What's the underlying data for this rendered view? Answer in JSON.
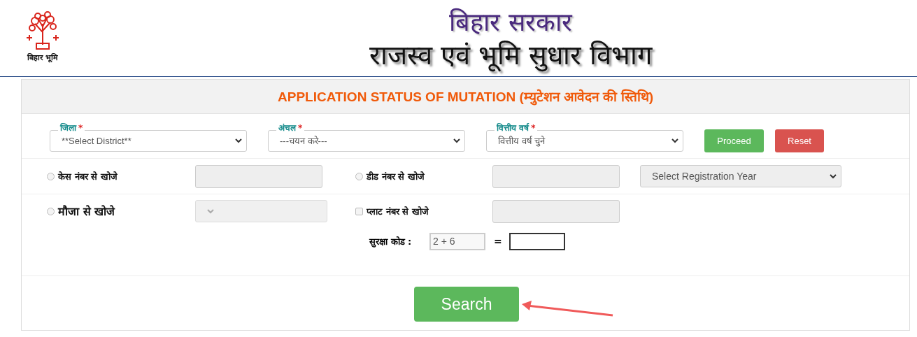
{
  "header": {
    "logo_caption": "बिहार भूमि",
    "title": "बिहार सरकार",
    "subtitle": "राजस्व एवं भूमि सुधार विभाग"
  },
  "form": {
    "heading": "APPLICATION STATUS OF MUTATION (म्युटेशन आवेदन की स्तिथि)",
    "filters": [
      {
        "label": "जिला",
        "required_mark": "*",
        "value": "**Select District**"
      },
      {
        "label": "अंचल",
        "required_mark": "*",
        "value": "---चयन करे---"
      },
      {
        "label": "वित्तीय वर्ष",
        "required_mark": "*",
        "value": "वित्तीय वर्ष चुने"
      }
    ],
    "buttons": [
      {
        "label": "Proceed",
        "kind": "success"
      },
      {
        "label": "Reset",
        "kind": "danger"
      }
    ],
    "search_rows": [
      {
        "items": [
          {
            "kind": "radio",
            "label": "केस नंबर से खोजे",
            "selected": false,
            "emphasis": false
          },
          {
            "kind": "text",
            "disabled": true
          },
          {
            "kind": "radio",
            "label": "डीड नंबर से खोजे",
            "selected": false,
            "emphasis": false
          },
          {
            "kind": "text",
            "disabled": true
          },
          {
            "kind": "select",
            "value": "Select Registration Year",
            "disabled": true
          }
        ]
      },
      {
        "items": [
          {
            "kind": "radio",
            "label": "मौजा से खोजे",
            "selected": false,
            "emphasis": true
          },
          {
            "kind": "select",
            "disabled": true
          },
          {
            "kind": "checkbox",
            "label": "प्लाट नंबर से खोजे",
            "checked": false
          },
          {
            "kind": "text",
            "disabled": true
          }
        ]
      }
    ],
    "security": {
      "label": "सुरक्षा कोड :",
      "captcha": "2 + 6",
      "equals": "="
    },
    "search_button": "Search"
  }
}
